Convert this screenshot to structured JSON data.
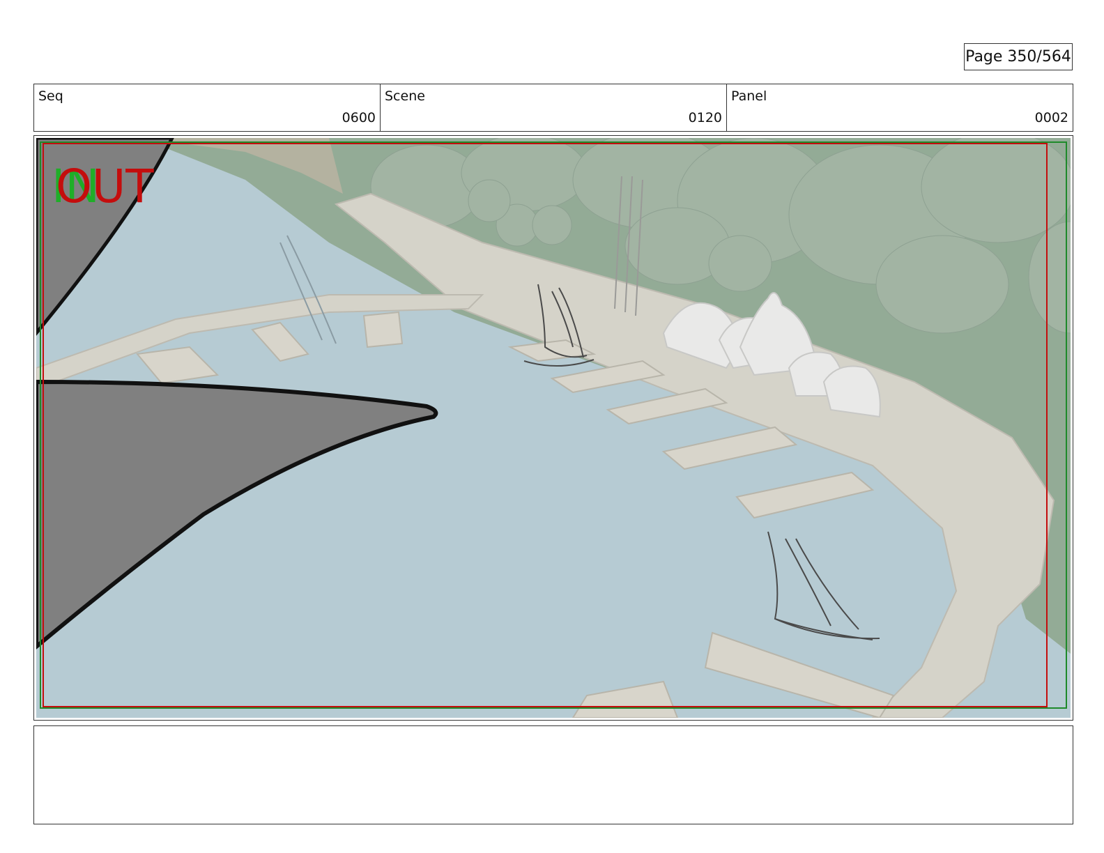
{
  "page": {
    "label": "Page 350/564"
  },
  "header": {
    "seq": {
      "label": "Seq",
      "value": "0600"
    },
    "scene": {
      "label": "Scene",
      "value": "0120"
    },
    "panel": {
      "label": "Panel",
      "value": "0002"
    }
  },
  "frame": {
    "in_marker": "IN",
    "out_marker": "OUT",
    "colors": {
      "water": "#b6cbd3",
      "hills": "#93ab96",
      "dock": "#d5d3c9",
      "shape_fill": "#808080",
      "in_color": "#1fae28",
      "out_color": "#c40d0d"
    }
  },
  "notes": {
    "text": ""
  }
}
